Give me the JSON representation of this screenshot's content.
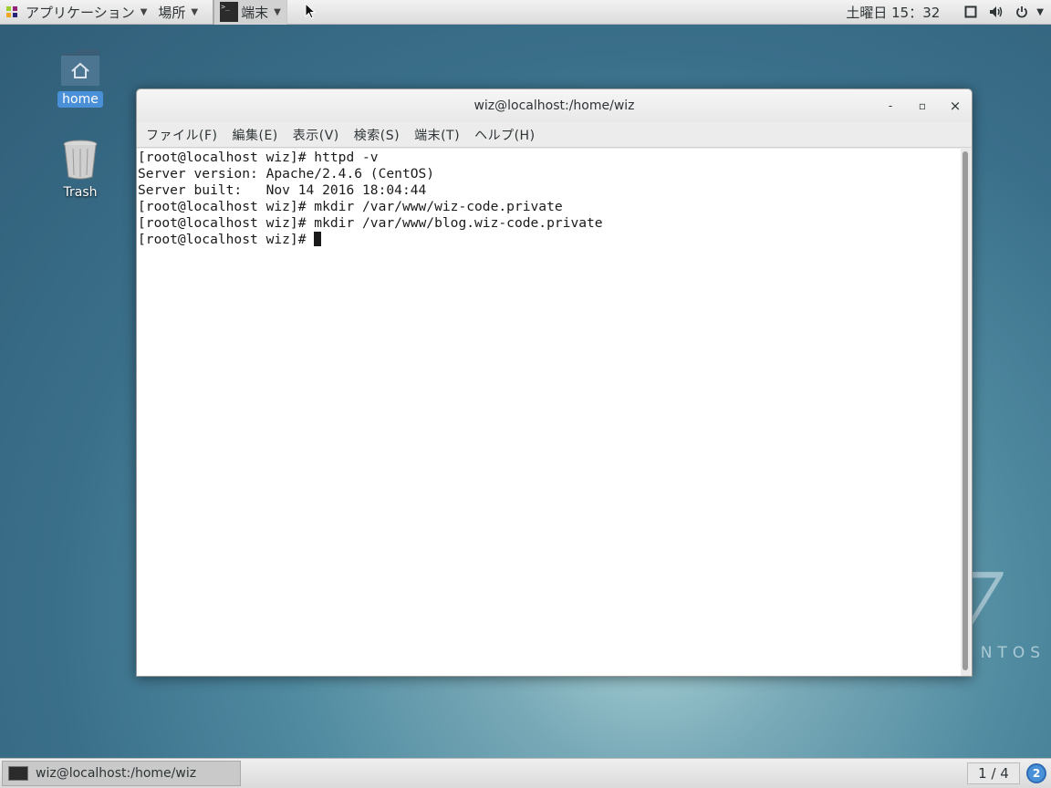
{
  "top_panel": {
    "applications_label": "アプリケーション",
    "places_label": "場所",
    "terminal_label": "端末",
    "clock": "土曜日 15：32"
  },
  "desktop": {
    "icons": [
      {
        "label": "home",
        "icon": "home-folder-icon",
        "selected": true
      },
      {
        "label": "Trash",
        "icon": "trash-icon",
        "selected": false
      }
    ],
    "watermark_number": "7",
    "watermark_text": "NTOS"
  },
  "window": {
    "title": "wiz@localhost:/home/wiz",
    "controls": {
      "minimize": "-",
      "maximize": "▫",
      "close": "×"
    },
    "menu": [
      "ファイル(F)",
      "編集(E)",
      "表示(V)",
      "検索(S)",
      "端末(T)",
      "ヘルプ(H)"
    ],
    "terminal_lines": [
      "[root@localhost wiz]# httpd -v",
      "Server version: Apache/2.4.6 (CentOS)",
      "Server built:   Nov 14 2016 18:04:44",
      "[root@localhost wiz]# mkdir /var/www/wiz-code.private",
      "[root@localhost wiz]# mkdir /var/www/blog.wiz-code.private",
      "[root@localhost wiz]# "
    ]
  },
  "bottom_panel": {
    "task_label": "wiz@localhost:/home/wiz",
    "workspace": "1 / 4",
    "notification_count": "2"
  }
}
